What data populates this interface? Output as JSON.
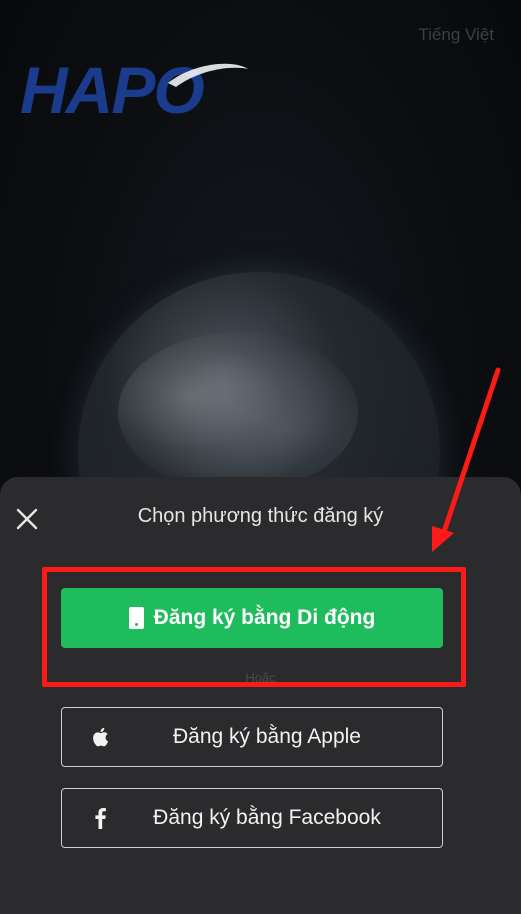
{
  "top": {
    "language": "Tiếng Việt",
    "logo_text": "HAPO"
  },
  "sheet": {
    "title": "Chọn phương thức đăng ký",
    "or_text": "Hoặc"
  },
  "buttons": {
    "mobile_label": "Đăng ký bằng Di động",
    "apple_label": "Đăng ký bằng Apple",
    "facebook_label": "Đăng ký bằng Facebook"
  },
  "icons": {
    "close": "close-icon",
    "phone": "phone-icon",
    "apple": "apple-icon",
    "facebook": "facebook-icon"
  },
  "colors": {
    "sheet_bg": "#2b2b2d",
    "primary_green": "#1ebc5c",
    "annotation_red": "#ff1a1a",
    "logo_blue": "#1b3c8c"
  }
}
